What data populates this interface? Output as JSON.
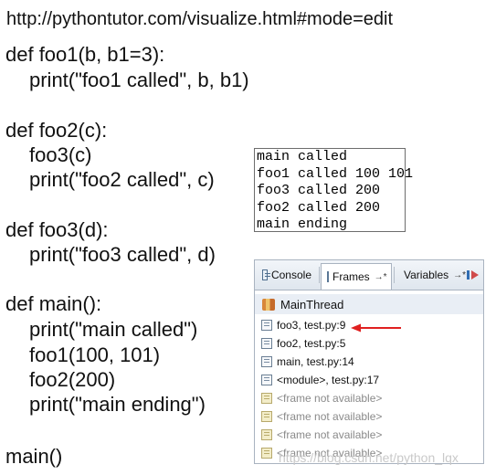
{
  "url": "http://pythontutor.com/visualize.html#mode=edit",
  "code": [
    {
      "text": "def foo1(b, b1=3):",
      "indent": false
    },
    {
      "text": "print(\"foo1 called\", b, b1)",
      "indent": true
    },
    {
      "text": "def foo2(c):",
      "indent": false
    },
    {
      "text": "foo3(c)",
      "indent": true
    },
    {
      "text": "print(\"foo2 called\", c)",
      "indent": true
    },
    {
      "text": "def foo3(d):",
      "indent": false
    },
    {
      "text": "print(\"foo3 called\", d)",
      "indent": true
    },
    {
      "text": "def main():",
      "indent": false
    },
    {
      "text": "print(\"main called\")",
      "indent": true
    },
    {
      "text": "foo1(100, 101)",
      "indent": true
    },
    {
      "text": "foo2(200)",
      "indent": true
    },
    {
      "text": "print(\"main ending\")",
      "indent": true
    },
    {
      "text": "main()",
      "indent": false
    }
  ],
  "console_output": [
    "main called",
    "foo1 called 100 101",
    "foo3 called 200",
    "foo2 called 200",
    "main ending"
  ],
  "ide": {
    "tabs": [
      {
        "label": "Console",
        "icon": "console-icon",
        "active": false,
        "extra": ""
      },
      {
        "label": "Frames",
        "icon": "frames-icon",
        "active": true,
        "extra": "→*"
      },
      {
        "label": "Variables",
        "icon": "variables-icon",
        "active": false,
        "extra": "→*"
      }
    ],
    "thread": "MainThread",
    "frames": [
      {
        "label": "foo3, test.py:9",
        "available": true,
        "highlighted": true
      },
      {
        "label": "foo2, test.py:5",
        "available": true
      },
      {
        "label": "main, test.py:14",
        "available": true
      },
      {
        "label": "<module>, test.py:17",
        "available": true
      },
      {
        "label": "<frame not available>",
        "available": false
      },
      {
        "label": "<frame not available>",
        "available": false
      },
      {
        "label": "<frame not available>",
        "available": false
      },
      {
        "label": "<frame not available>",
        "available": false
      }
    ]
  },
  "watermark": "https://blog.csdn.net/python_lqx",
  "colors": {
    "arrow": "#e02020",
    "tab_bar": "#dfe6ee"
  }
}
